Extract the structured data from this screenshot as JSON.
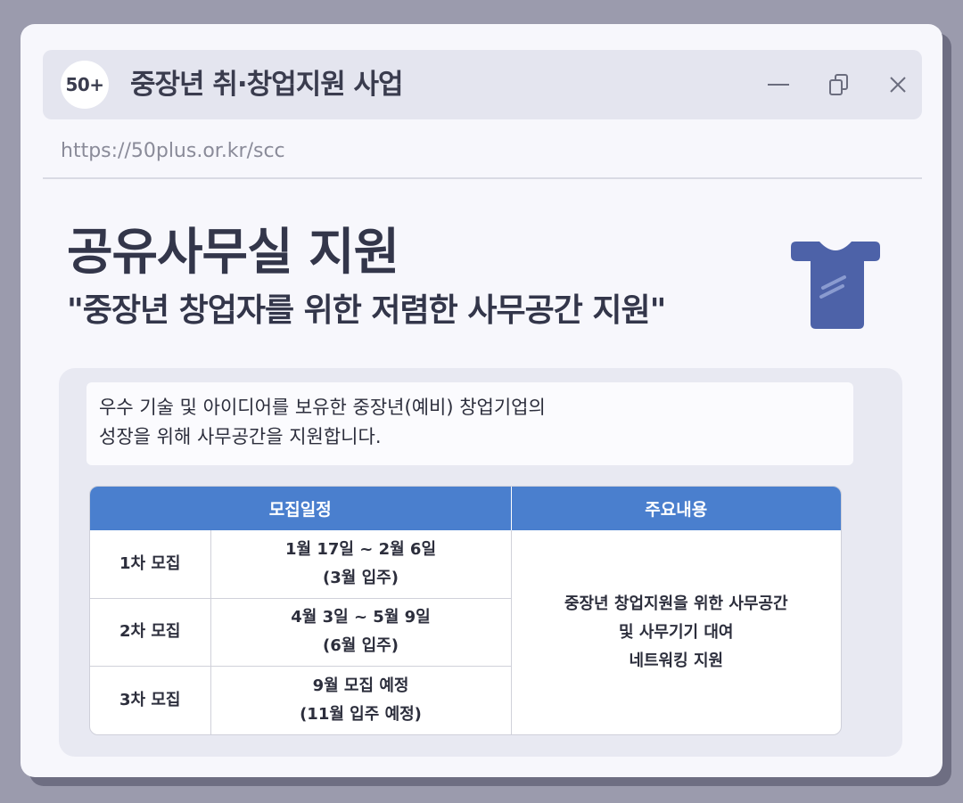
{
  "window": {
    "logo_text": "50+",
    "title": "중장년 취·창업지원 사업",
    "url": "https://50plus.or.kr/scc",
    "controls": {
      "minimize_icon": "minimize-icon",
      "restore_icon": "copy-icon",
      "close_icon": "close-icon"
    }
  },
  "header": {
    "title": "공유사무실 지원",
    "subtitle": "\"중장년 창업자를 위한 저렴한 사무공간 지원\"",
    "icon": "shirt-icon"
  },
  "intro": {
    "line1": "우수 기술 및 아이디어를 보유한 중장년(예비) 창업기업의",
    "line2": "성장을 위해 사무공간을 지원합니다."
  },
  "table": {
    "headers": [
      "모집일정",
      "주요내용"
    ],
    "rows": [
      {
        "round": "1차 모집",
        "period": "1월 17일 ~ 2월 6일",
        "move_in": "(3월 입주)"
      },
      {
        "round": "2차 모집",
        "period": "4월 3일 ~ 5월 9일",
        "move_in": "(6월 입주)"
      },
      {
        "round": "3차 모집",
        "period": "9월 모집 예정",
        "move_in": "(11월 입주 예정)"
      }
    ],
    "content": [
      "중장년 창업지원을 위한 사무공간",
      "및 사무기기 대여",
      "네트워킹 지원"
    ]
  },
  "colors": {
    "accent": "#4a7fce",
    "icon": "#4d62a8",
    "text": "#33364a"
  }
}
